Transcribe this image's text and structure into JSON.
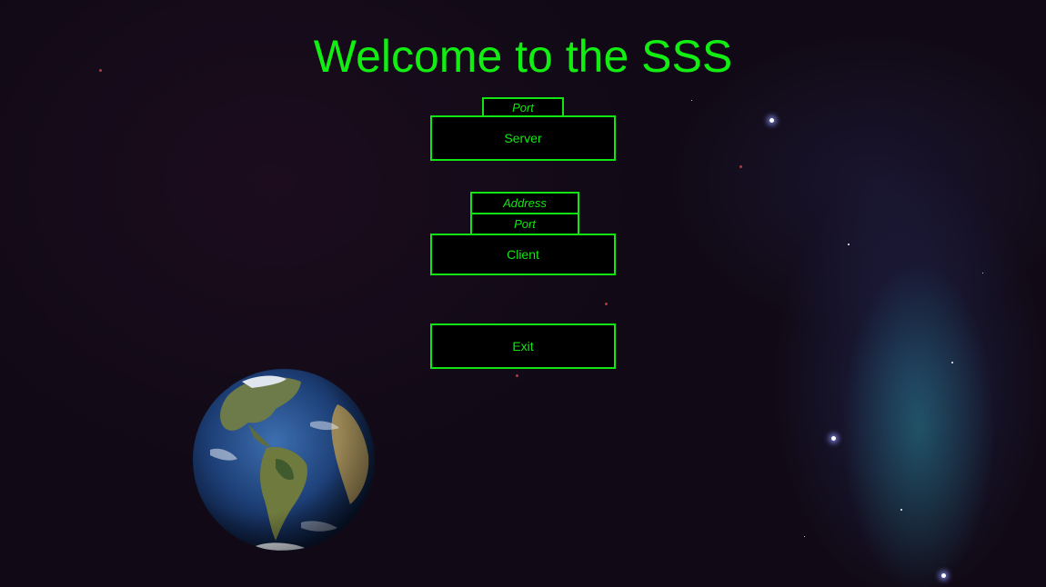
{
  "title": "Welcome to the SSS",
  "server": {
    "port_placeholder": "Port",
    "button_label": "Server"
  },
  "client": {
    "address_placeholder": "Address",
    "port_placeholder": "Port",
    "button_label": "Client"
  },
  "exit": {
    "button_label": "Exit"
  },
  "colors": {
    "accent": "#12e612",
    "background": "#110a16"
  },
  "icons": {
    "planet": "earth-icon"
  }
}
